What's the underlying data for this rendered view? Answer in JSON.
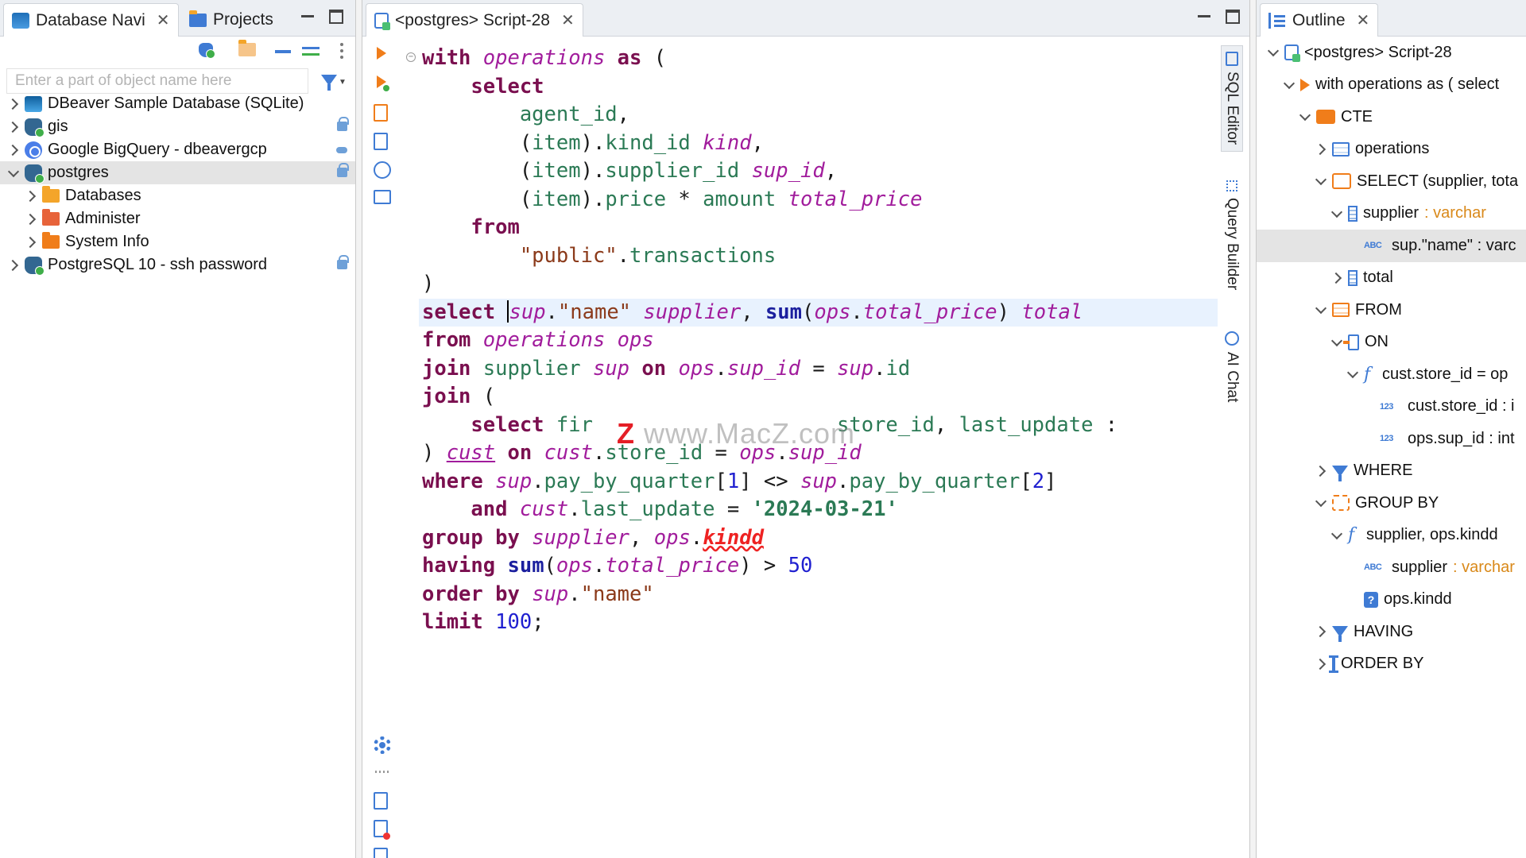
{
  "left_panel": {
    "tabs": [
      {
        "label": "Database Navi",
        "active": true
      },
      {
        "label": "Projects",
        "active": false
      }
    ],
    "filter_placeholder": "Enter a part of object name here",
    "tree": [
      {
        "label": "DBeaver Sample Database (SQLite)",
        "icon": "sqlite-db-icon",
        "depth": 0,
        "expanded": false
      },
      {
        "label": "gis",
        "icon": "postgres-db-icon",
        "depth": 0,
        "expanded": false,
        "badge": "lock-icon"
      },
      {
        "label": "Google BigQuery - dbeavergcp",
        "icon": "bigquery-icon",
        "depth": 0,
        "expanded": false,
        "badge": "cloud-icon"
      },
      {
        "label": "postgres",
        "icon": "postgres-db-icon",
        "depth": 0,
        "expanded": true,
        "selected": true,
        "badge": "lock-icon"
      },
      {
        "label": "Databases",
        "icon": "folder-icon",
        "depth": 1,
        "expanded": false
      },
      {
        "label": "Administer",
        "icon": "folder-icon",
        "depth": 1,
        "expanded": false
      },
      {
        "label": "System Info",
        "icon": "folder-icon",
        "depth": 1,
        "expanded": false
      },
      {
        "label": "PostgreSQL 10 - ssh password",
        "icon": "postgres-db-icon",
        "depth": 0,
        "expanded": false,
        "badge": "lock-icon"
      }
    ]
  },
  "editor": {
    "tab_label": "<postgres> Script-28",
    "side_tabs": [
      "SQL Editor",
      "Query Builder",
      "AI Chat"
    ],
    "watermark": {
      "z": "Z",
      "text": " www.MacZ.com"
    },
    "code": [
      [
        [
          "kw",
          "with"
        ],
        [
          "p",
          " "
        ],
        [
          "al",
          "operations"
        ],
        [
          "p",
          " "
        ],
        [
          "kw",
          "as"
        ],
        [
          "p",
          " ("
        ]
      ],
      [
        [
          "p",
          "    "
        ],
        [
          "kw",
          "select"
        ]
      ],
      [
        [
          "p",
          "        "
        ],
        [
          "id",
          "agent_id"
        ],
        [
          "p",
          ","
        ]
      ],
      [
        [
          "p",
          "        ("
        ],
        [
          "id",
          "item"
        ],
        [
          "p",
          ")."
        ],
        [
          "id",
          "kind_id"
        ],
        [
          "p",
          " "
        ],
        [
          "al",
          "kind"
        ],
        [
          "p",
          ","
        ]
      ],
      [
        [
          "p",
          "        ("
        ],
        [
          "id",
          "item"
        ],
        [
          "p",
          ")."
        ],
        [
          "id",
          "supplier_id"
        ],
        [
          "p",
          " "
        ],
        [
          "al",
          "sup_id"
        ],
        [
          "p",
          ","
        ]
      ],
      [
        [
          "p",
          "        ("
        ],
        [
          "id",
          "item"
        ],
        [
          "p",
          ")."
        ],
        [
          "id",
          "price"
        ],
        [
          "p",
          " * "
        ],
        [
          "id",
          "amount"
        ],
        [
          "p",
          " "
        ],
        [
          "al",
          "total_price"
        ]
      ],
      [
        [
          "p",
          "    "
        ],
        [
          "kw",
          "from"
        ]
      ],
      [
        [
          "p",
          "        "
        ],
        [
          "str",
          "\"public\""
        ],
        [
          "p",
          "."
        ],
        [
          "id",
          "transactions"
        ]
      ],
      [
        [
          "p",
          ")"
        ]
      ],
      [
        [
          "kw",
          "select"
        ],
        [
          "p",
          " "
        ],
        [
          "caret",
          ""
        ],
        [
          "al",
          "sup"
        ],
        [
          "p",
          "."
        ],
        [
          "str",
          "\"name\""
        ],
        [
          "p",
          " "
        ],
        [
          "al",
          "supplier"
        ],
        [
          "p",
          ", "
        ],
        [
          "fn",
          "sum"
        ],
        [
          "p",
          "("
        ],
        [
          "al",
          "ops"
        ],
        [
          "p",
          "."
        ],
        [
          "al",
          "total_price"
        ],
        [
          "p",
          ") "
        ],
        [
          "al",
          "total"
        ]
      ],
      [
        [
          "kw",
          "from"
        ],
        [
          "p",
          " "
        ],
        [
          "al",
          "operations"
        ],
        [
          "p",
          " "
        ],
        [
          "al",
          "ops"
        ]
      ],
      [
        [
          "kw",
          "join"
        ],
        [
          "p",
          " "
        ],
        [
          "id",
          "supplier"
        ],
        [
          "p",
          " "
        ],
        [
          "al",
          "sup"
        ],
        [
          "p",
          " "
        ],
        [
          "kw",
          "on"
        ],
        [
          "p",
          " "
        ],
        [
          "al",
          "ops"
        ],
        [
          "p",
          "."
        ],
        [
          "al",
          "sup_id"
        ],
        [
          "p",
          " = "
        ],
        [
          "al",
          "sup"
        ],
        [
          "p",
          "."
        ],
        [
          "id",
          "id"
        ]
      ],
      [
        [
          "kw",
          "join"
        ],
        [
          "p",
          " ("
        ]
      ],
      [
        [
          "p",
          "    "
        ],
        [
          "kw",
          "select"
        ],
        [
          "p",
          " "
        ],
        [
          "id",
          "fir"
        ],
        [
          "p",
          "                    "
        ],
        [
          "id",
          "store_id"
        ],
        [
          "p",
          ", "
        ],
        [
          "id",
          "last_update"
        ],
        [
          "p",
          " :"
        ]
      ],
      [
        [
          "p",
          ") "
        ],
        [
          "al under",
          "cust"
        ],
        [
          "p",
          " "
        ],
        [
          "kw",
          "on"
        ],
        [
          "p",
          " "
        ],
        [
          "al",
          "cust"
        ],
        [
          "p",
          "."
        ],
        [
          "id",
          "store_id"
        ],
        [
          "p",
          " = "
        ],
        [
          "al",
          "ops"
        ],
        [
          "p",
          "."
        ],
        [
          "al",
          "sup_id"
        ]
      ],
      [
        [
          "kw",
          "where"
        ],
        [
          "p",
          " "
        ],
        [
          "al",
          "sup"
        ],
        [
          "p",
          "."
        ],
        [
          "id",
          "pay_by_quarter"
        ],
        [
          "p",
          "["
        ],
        [
          "num",
          "1"
        ],
        [
          "p",
          "] <> "
        ],
        [
          "al",
          "sup"
        ],
        [
          "p",
          "."
        ],
        [
          "id",
          "pay_by_quarter"
        ],
        [
          "p",
          "["
        ],
        [
          "num",
          "2"
        ],
        [
          "p",
          "]"
        ]
      ],
      [
        [
          "p",
          "    "
        ],
        [
          "kw",
          "and"
        ],
        [
          "p",
          " "
        ],
        [
          "al",
          "cust"
        ],
        [
          "p",
          "."
        ],
        [
          "id",
          "last_update"
        ],
        [
          "p",
          " = "
        ],
        [
          "dstr",
          "'2024-03-21'"
        ]
      ],
      [
        [
          "kw",
          "group by"
        ],
        [
          "p",
          " "
        ],
        [
          "al",
          "supplier"
        ],
        [
          "p",
          ", "
        ],
        [
          "al",
          "ops"
        ],
        [
          "p",
          "."
        ],
        [
          "err",
          "kindd"
        ]
      ],
      [
        [
          "kw",
          "having"
        ],
        [
          "p",
          " "
        ],
        [
          "fn",
          "sum"
        ],
        [
          "p",
          "("
        ],
        [
          "al",
          "ops"
        ],
        [
          "p",
          "."
        ],
        [
          "al",
          "total_price"
        ],
        [
          "p",
          ") > "
        ],
        [
          "num",
          "50"
        ]
      ],
      [
        [
          "kw",
          "order by"
        ],
        [
          "p",
          " "
        ],
        [
          "al",
          "sup"
        ],
        [
          "p",
          "."
        ],
        [
          "str",
          "\"name\""
        ]
      ],
      [
        [
          "kw",
          "limit"
        ],
        [
          "p",
          " "
        ],
        [
          "num",
          "100"
        ],
        [
          "p",
          ";"
        ]
      ]
    ]
  },
  "outline": {
    "tab_label": "Outline",
    "tree": [
      {
        "label": "<postgres> Script-28",
        "icon": "script-icon",
        "depth": 0,
        "chev": "open"
      },
      {
        "label": "with operations as ( select",
        "icon": "play-icon",
        "depth": 1,
        "chev": "open"
      },
      {
        "label": "CTE",
        "icon": "cte-icon",
        "depth": 2,
        "chev": "open"
      },
      {
        "label": "operations",
        "icon": "table-icon",
        "depth": 3,
        "chev": "closed"
      },
      {
        "label": "SELECT (supplier, tota",
        "icon": "select-icon",
        "depth": 3,
        "chev": "open"
      },
      {
        "label": "supplier",
        "type": " : varchar",
        "icon": "column-icon",
        "depth": 4,
        "chev": "open"
      },
      {
        "label": "sup.\"name\" : varc",
        "icon": "abc-icon",
        "depth": 5,
        "chev": "none",
        "selected": true
      },
      {
        "label": "total",
        "icon": "column-icon",
        "depth": 4,
        "chev": "closed"
      },
      {
        "label": "FROM",
        "icon": "from-icon",
        "depth": 3,
        "chev": "open"
      },
      {
        "label": "ON",
        "icon": "on-icon",
        "depth": 4,
        "chev": "open"
      },
      {
        "label": "cust.store_id = op",
        "icon": "function-icon",
        "depth": 5,
        "chev": "open"
      },
      {
        "label": "cust.store_id : i",
        "icon": "number-icon",
        "depth": 6,
        "chev": "none"
      },
      {
        "label": "ops.sup_id : int",
        "icon": "number-icon",
        "depth": 6,
        "chev": "none"
      },
      {
        "label": "WHERE",
        "icon": "filter-icon",
        "depth": 3,
        "chev": "closed"
      },
      {
        "label": "GROUP BY",
        "icon": "group-icon",
        "depth": 3,
        "chev": "open"
      },
      {
        "label": "supplier, ops.kindd",
        "icon": "function-icon",
        "depth": 4,
        "chev": "open"
      },
      {
        "label": "supplier",
        "type": " : varchar",
        "icon": "abc-icon",
        "depth": 5,
        "chev": "none"
      },
      {
        "label": "ops.kindd",
        "icon": "unknown-icon",
        "depth": 5,
        "chev": "none"
      },
      {
        "label": "HAVING",
        "icon": "filter-icon",
        "depth": 3,
        "chev": "closed"
      },
      {
        "label": "ORDER BY",
        "icon": "order-icon",
        "depth": 3,
        "chev": "closed"
      }
    ]
  }
}
